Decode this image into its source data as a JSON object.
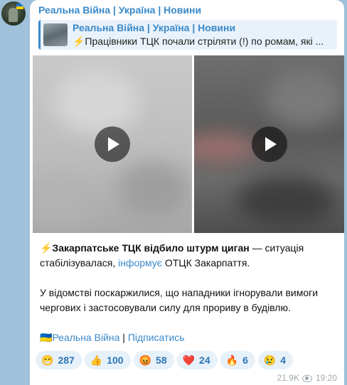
{
  "channel": {
    "name": "Реальна Війна | Україна | Новини"
  },
  "reply": {
    "title": "Реальна Війна | Україна | Новини",
    "text": "⚡️Працівники ТЦК почали стріляти (!) по ромам, які ..."
  },
  "media": {
    "videos": [
      {
        "label": "video-1"
      },
      {
        "label": "video-2"
      }
    ]
  },
  "post": {
    "p1_bold": "⚡️Закарпатське ТЦК відбило штурм циган",
    "p1_rest": " — ситуація стабілізувалася, ",
    "p1_link": "інформує",
    "p1_end": " ОТЦК Закарпаття.",
    "p2": "У відомстві поскаржилися, що нападники ігнорували вимоги чергових і застосовували силу для прориву в будівлю.",
    "footer_flag": "🇺🇦",
    "footer_channel": "Реальна Війна",
    "footer_sep": " | ",
    "footer_subscribe": "Підписатись"
  },
  "reactions": [
    {
      "emoji": "😁",
      "count": "287"
    },
    {
      "emoji": "👍",
      "count": "100"
    },
    {
      "emoji": "😡",
      "count": "58"
    },
    {
      "emoji": "❤️",
      "count": "24"
    },
    {
      "emoji": "🔥",
      "count": "6"
    },
    {
      "emoji": "😢",
      "count": "4"
    }
  ],
  "meta": {
    "views": "21.9K",
    "time": "19:20"
  }
}
